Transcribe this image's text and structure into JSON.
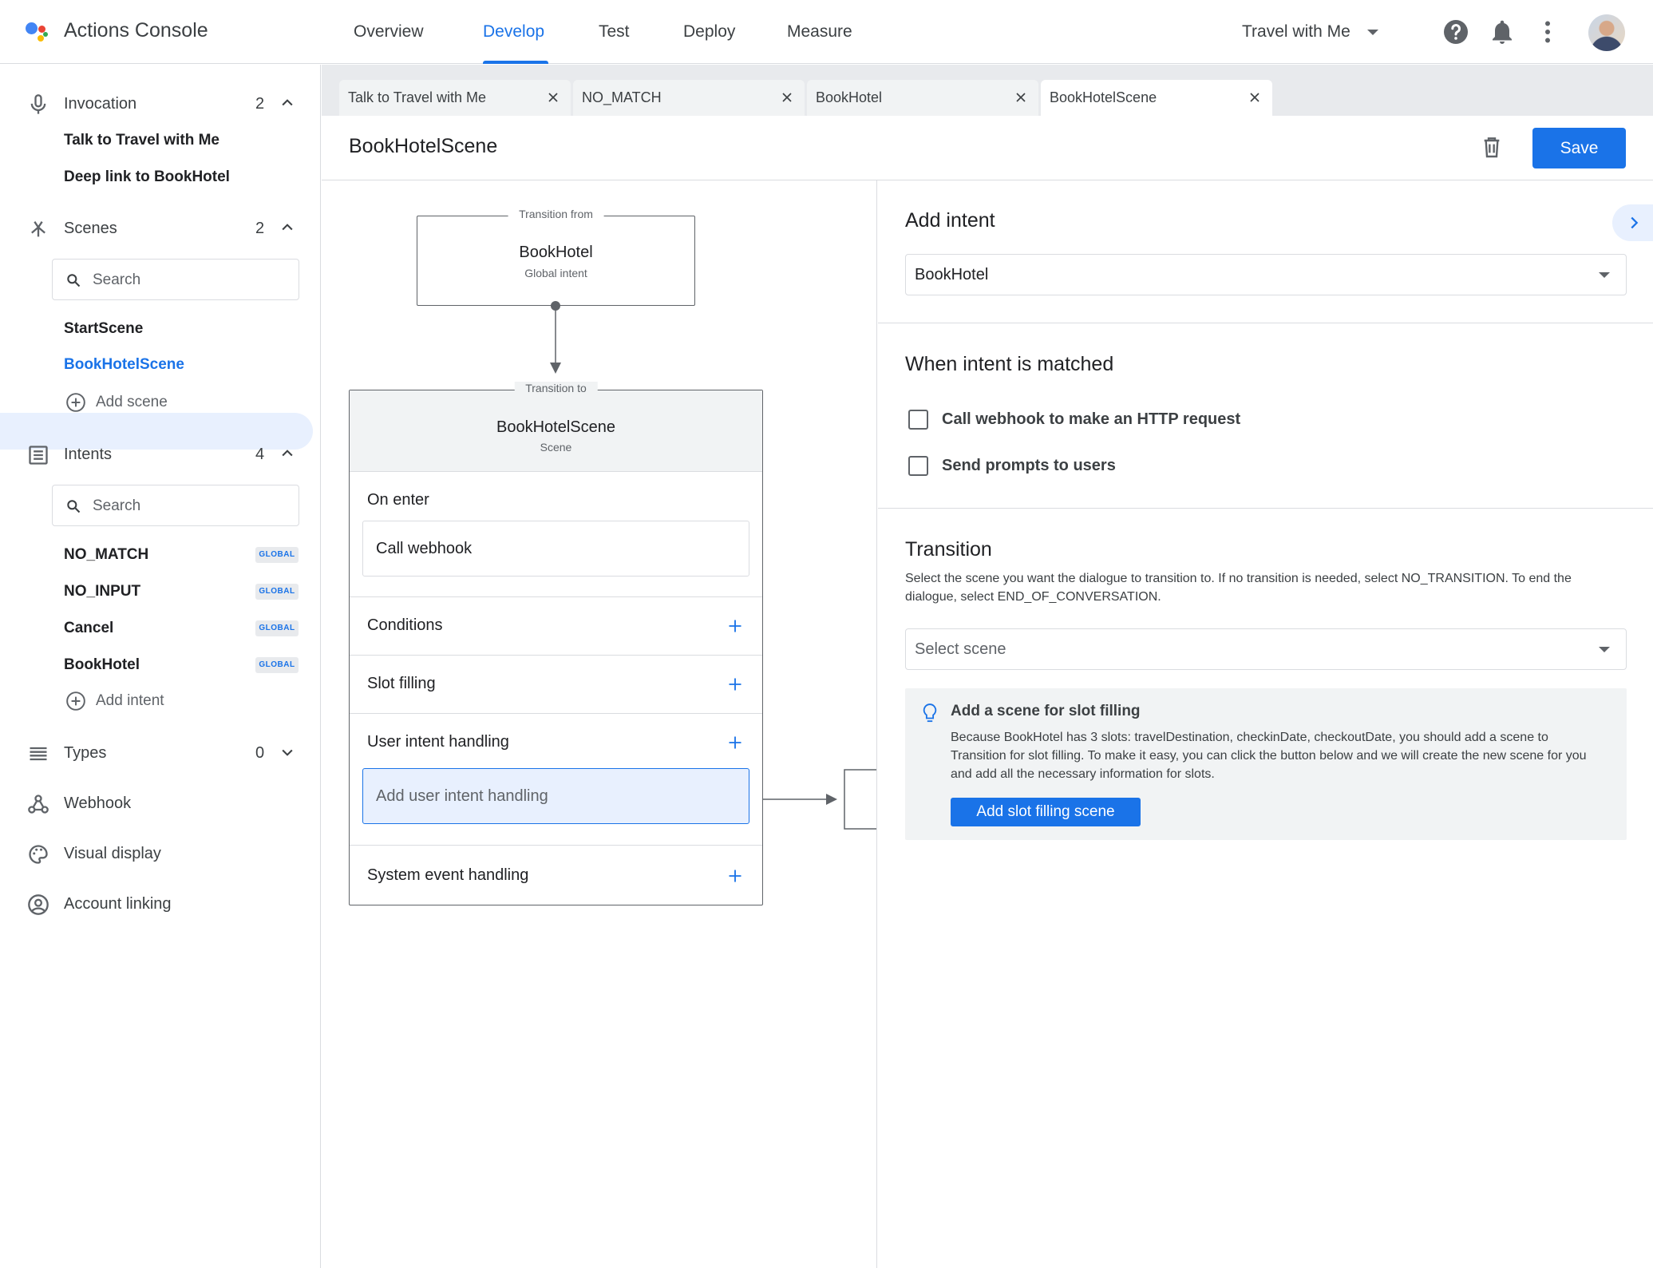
{
  "app": {
    "title": "Actions Console",
    "nav": [
      "Overview",
      "Develop",
      "Test",
      "Deploy",
      "Measure"
    ],
    "active_nav": "Develop",
    "project": "Travel with Me"
  },
  "sidebar": {
    "invocation": {
      "label": "Invocation",
      "count": "2",
      "items": [
        "Talk to Travel with Me",
        "Deep link to BookHotel"
      ]
    },
    "scenes": {
      "label": "Scenes",
      "count": "2",
      "search_placeholder": "Search",
      "items": [
        "StartScene",
        "BookHotelScene"
      ],
      "selected": "BookHotelScene",
      "add_label": "Add scene"
    },
    "intents": {
      "label": "Intents",
      "count": "4",
      "search_placeholder": "Search",
      "items": [
        {
          "name": "NO_MATCH",
          "badge": "GLOBAL"
        },
        {
          "name": "NO_INPUT",
          "badge": "GLOBAL"
        },
        {
          "name": "Cancel",
          "badge": "GLOBAL"
        },
        {
          "name": "BookHotel",
          "badge": "GLOBAL"
        }
      ],
      "add_label": "Add intent"
    },
    "types": {
      "label": "Types",
      "count": "0"
    },
    "webhook": {
      "label": "Webhook"
    },
    "visual_display": {
      "label": "Visual display"
    },
    "account_linking": {
      "label": "Account linking"
    }
  },
  "tabs": [
    "Talk to Travel with Me",
    "NO_MATCH",
    "BookHotel",
    "BookHotelScene"
  ],
  "active_tab": "BookHotelScene",
  "editor": {
    "title": "BookHotelScene",
    "save_label": "Save"
  },
  "canvas": {
    "from": {
      "legend": "Transition from",
      "title": "BookHotel",
      "subtitle": "Global intent"
    },
    "to": {
      "legend": "Transition to",
      "title": "BookHotelScene",
      "subtitle": "Scene"
    },
    "on_enter_label": "On enter",
    "on_enter_value": "Call webhook",
    "conditions_label": "Conditions",
    "slot_filling_label": "Slot filling",
    "user_intent_label": "User intent handling",
    "add_user_intent_label": "Add user intent handling",
    "system_event_label": "System event handling"
  },
  "panel": {
    "add_intent_heading": "Add intent",
    "intent_value": "BookHotel",
    "when_matched_heading": "When intent is matched",
    "checkbox_webhook": "Call webhook to make an HTTP request",
    "checkbox_prompts": "Send prompts to users",
    "transition_heading": "Transition",
    "transition_desc": "Select the scene you want the dialogue to transition to. If no transition is needed, select NO_TRANSITION. To end the dialogue, select END_OF_CONVERSATION.",
    "select_scene_placeholder": "Select scene",
    "tip_title": "Add a scene for slot filling",
    "tip_body": "Because BookHotel has 3 slots: travelDestination, checkinDate, checkoutDate, you should add a scene to Transition for slot filling. To make it easy, you can click the button below and we will create the new scene for you and add all the necessary information for slots.",
    "tip_button": "Add slot filling scene"
  },
  "colors": {
    "accent": "#1a73e8",
    "selected_bg": "#e8f0fe",
    "border": "#dadce0"
  },
  "icons": [
    "assistant-logo-icon",
    "help-icon",
    "bell-icon",
    "more-vert-icon",
    "mic-icon",
    "scenes-icon",
    "intents-icon",
    "types-icon",
    "webhook-icon",
    "palette-icon",
    "account-icon",
    "search-icon",
    "add-circle-icon",
    "close-icon",
    "trash-icon",
    "plus-icon",
    "lightbulb-icon",
    "chevron-right-icon"
  ]
}
